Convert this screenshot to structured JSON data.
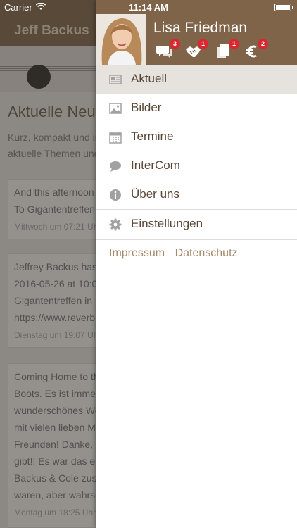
{
  "status_bar": {
    "carrier": "Carrier",
    "time": "11:14 AM"
  },
  "background_page": {
    "nav_title": "Jeff Backus",
    "heading": "Aktuelle Neu",
    "intro": "Kurz, kompakt und in\naktuelle Themen und",
    "cards": [
      {
        "text": "And this afternoon\nTo Gigantentreffen",
        "meta": "Mittwoch um 07:21 Uh"
      },
      {
        "text": "Jeffrey Backus has\n2016-05-26 at 10:0\nGigantentreffen in\nhttps://www.reverb",
        "meta": "Dienstag um 19:07 Uh"
      },
      {
        "text": "Coming Home to th\nBoots. Es ist imme\nwunderschönes We\nmit vielen lieben M\nFreunden! Danke, d\ngibt!! Es war das er\nBackus & Cole zusa\nwaren, aber wahrsc",
        "meta": "Montag um 18:25 Uhr"
      }
    ]
  },
  "drawer": {
    "user_name": "Lisa Friedman",
    "header_icons": [
      {
        "icon": "chat-bubbles-icon",
        "badge": "3"
      },
      {
        "icon": "handshake-icon",
        "badge": "1"
      },
      {
        "icon": "documents-icon",
        "badge": "1"
      },
      {
        "icon": "euro-icon",
        "badge": "2"
      }
    ],
    "menu": [
      {
        "icon": "newspaper-icon",
        "label": "Aktuell",
        "active": true
      },
      {
        "icon": "picture-icon",
        "label": "Bilder"
      },
      {
        "icon": "calendar-icon",
        "label": "Termine"
      },
      {
        "icon": "speech-bubble-icon",
        "label": "InterCom"
      },
      {
        "icon": "info-icon",
        "label": "Über uns"
      }
    ],
    "settings_label": "Einstellungen",
    "footer_links": [
      "Impressum",
      "Datenschutz"
    ],
    "colors": {
      "header": "#806449",
      "active_row": "#e6e3df",
      "badge": "#d9282f",
      "link": "#a38966",
      "icon": "#a1a1a1"
    }
  }
}
